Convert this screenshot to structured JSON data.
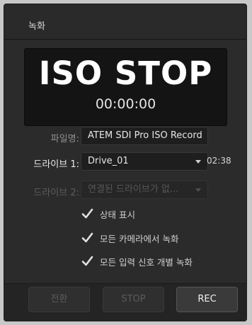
{
  "window": {
    "title": "녹화"
  },
  "display": {
    "status": "ISO STOP",
    "timecode": "00:00:00"
  },
  "filename": {
    "label": "파일명:",
    "value": "ATEM SDI Pro ISO Record"
  },
  "drive1": {
    "label": "드라이브 1:",
    "value": "Drive_01",
    "time_remaining": "02:38"
  },
  "drive2": {
    "label": "드라이브 2:",
    "value": "연결된 드라이브가 없..."
  },
  "options": [
    {
      "label": "상태 표시",
      "checked": true
    },
    {
      "label": "모든 카메라에서 녹화",
      "checked": true
    },
    {
      "label": "모든 입력 신호 개별 녹화",
      "checked": true
    }
  ],
  "buttons": {
    "switch": "전환",
    "stop": "STOP",
    "rec": "REC"
  },
  "icons": {
    "check": "checkmark-icon",
    "dropdown": "chevron-down-icon"
  },
  "colors": {
    "panel": "#2b2b2b",
    "display_bg": "#141414",
    "text_primary": "#ffffff"
  }
}
